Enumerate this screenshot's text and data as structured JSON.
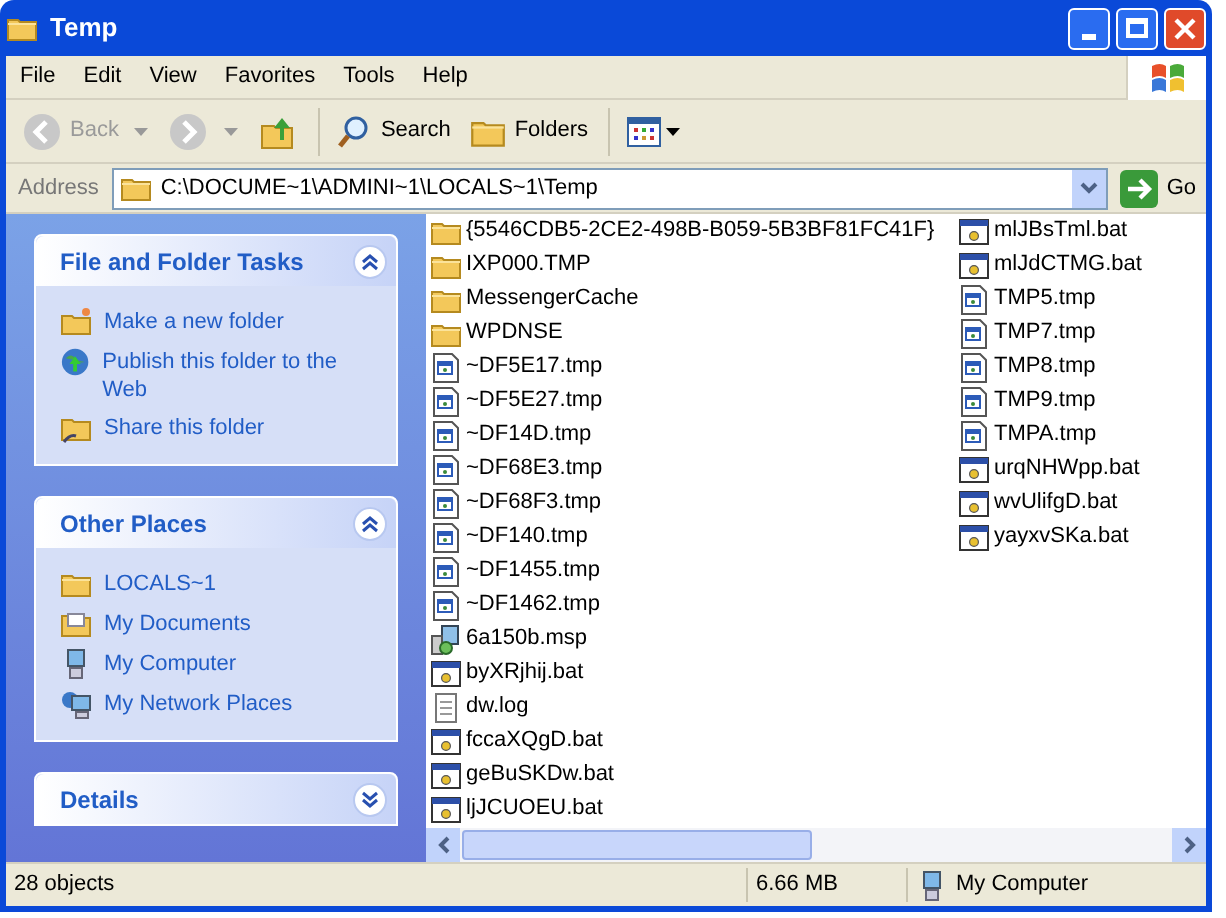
{
  "window": {
    "title": "Temp"
  },
  "menu": [
    "File",
    "Edit",
    "View",
    "Favorites",
    "Tools",
    "Help"
  ],
  "toolbar": [
    {
      "kind": "back",
      "label": "Back",
      "disabled": true
    },
    {
      "kind": "forward",
      "disabled": true
    },
    {
      "kind": "up"
    },
    {
      "kind": "search",
      "label": "Search"
    },
    {
      "kind": "folders",
      "label": "Folders"
    },
    {
      "kind": "views"
    }
  ],
  "address": {
    "label": "Address",
    "value": "C:\\DOCUME~1\\ADMINI~1\\LOCALS~1\\Temp",
    "go": "Go"
  },
  "panels": [
    {
      "title": "File and Folder Tasks",
      "expanded": true,
      "items": [
        {
          "kind": "newfolder",
          "label": "Make a new folder"
        },
        {
          "kind": "publish",
          "label": "Publish this folder to the Web"
        },
        {
          "kind": "share",
          "label": "Share this folder"
        }
      ]
    },
    {
      "title": "Other Places",
      "expanded": true,
      "items": [
        {
          "kind": "folder",
          "label": "LOCALS~1"
        },
        {
          "kind": "documents",
          "label": "My Documents"
        },
        {
          "kind": "computer",
          "label": "My Computer"
        },
        {
          "kind": "network",
          "label": "My Network Places"
        }
      ]
    },
    {
      "title": "Details",
      "expanded": false
    }
  ],
  "files": [
    [
      {
        "kind": "folder",
        "name": "{5546CDB5-2CE2-498B-B059-5B3BF81FC41F}"
      },
      {
        "kind": "folder",
        "name": "IXP000.TMP"
      },
      {
        "kind": "folder",
        "name": "MessengerCache"
      },
      {
        "kind": "folder",
        "name": "WPDNSE"
      },
      {
        "kind": "tmp",
        "name": "~DF5E17.tmp"
      },
      {
        "kind": "tmp",
        "name": "~DF5E27.tmp"
      },
      {
        "kind": "tmp",
        "name": "~DF14D.tmp"
      },
      {
        "kind": "tmp",
        "name": "~DF68E3.tmp"
      },
      {
        "kind": "tmp",
        "name": "~DF68F3.tmp"
      },
      {
        "kind": "tmp",
        "name": "~DF140.tmp"
      },
      {
        "kind": "tmp",
        "name": "~DF1455.tmp"
      },
      {
        "kind": "tmp",
        "name": "~DF1462.tmp"
      },
      {
        "kind": "msp",
        "name": "6a150b.msp"
      },
      {
        "kind": "bat",
        "name": "byXRjhij.bat"
      },
      {
        "kind": "log",
        "name": "dw.log"
      },
      {
        "kind": "bat",
        "name": "fccaXQgD.bat"
      },
      {
        "kind": "bat",
        "name": "geBuSKDw.bat"
      },
      {
        "kind": "bat",
        "name": "ljJCUOEU.bat"
      }
    ],
    [
      {
        "kind": "bat",
        "name": "mlJBsTml.bat"
      },
      {
        "kind": "bat",
        "name": "mlJdCTMG.bat"
      },
      {
        "kind": "tmp",
        "name": "TMP5.tmp"
      },
      {
        "kind": "tmp",
        "name": "TMP7.tmp"
      },
      {
        "kind": "tmp",
        "name": "TMP8.tmp"
      },
      {
        "kind": "tmp",
        "name": "TMP9.tmp"
      },
      {
        "kind": "tmp",
        "name": "TMPA.tmp"
      },
      {
        "kind": "bat",
        "name": "urqNHWpp.bat"
      },
      {
        "kind": "bat",
        "name": "wvUlifgD.bat"
      },
      {
        "kind": "bat",
        "name": "yayxvSKa.bat"
      }
    ]
  ],
  "status_bar": {
    "objects": "28 objects",
    "size": "6.66 MB",
    "location": "My Computer"
  }
}
